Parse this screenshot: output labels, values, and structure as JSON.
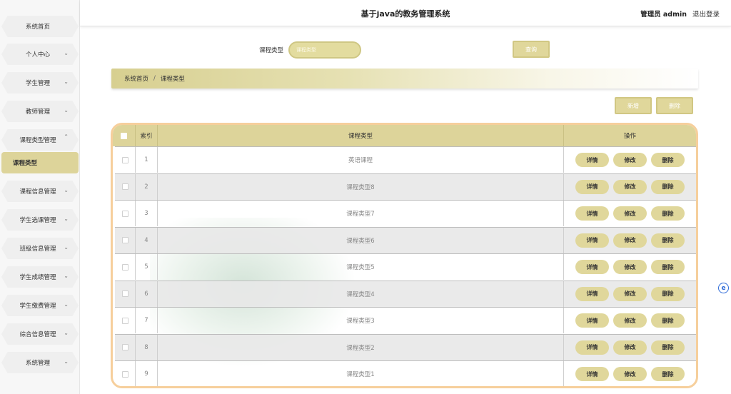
{
  "header": {
    "title": "基于java的教务管理系统",
    "user_label": "管理员 admin",
    "logout_label": "退出登录"
  },
  "sidebar": {
    "items": [
      {
        "label": "系统首页",
        "has_chevron": false
      },
      {
        "label": "个人中心",
        "has_chevron": true
      },
      {
        "label": "学生管理",
        "has_chevron": true
      },
      {
        "label": "教师管理",
        "has_chevron": true
      },
      {
        "label": "课程类型管理",
        "has_chevron": true,
        "expanded": true
      },
      {
        "label": "课程类型",
        "active": true
      },
      {
        "label": "课程信息管理",
        "has_chevron": true
      },
      {
        "label": "学生选课管理",
        "has_chevron": true
      },
      {
        "label": "班级信息管理",
        "has_chevron": true
      },
      {
        "label": "学生成绩管理",
        "has_chevron": true
      },
      {
        "label": "学生缴费管理",
        "has_chevron": true
      },
      {
        "label": "综合信息管理",
        "has_chevron": true
      },
      {
        "label": "系统管理",
        "has_chevron": true
      }
    ]
  },
  "search": {
    "label": "课程类型",
    "placeholder": "课程类型",
    "query_label": "查询"
  },
  "breadcrumb": {
    "home": "系统首页",
    "separator": "/",
    "current": "课程类型"
  },
  "actions": {
    "add_label": "新增",
    "delete_label": "删除"
  },
  "table": {
    "headers": {
      "index": "索引",
      "type": "课程类型",
      "ops": "操作"
    },
    "op_labels": {
      "detail": "详情",
      "edit": "修改",
      "delete": "删除"
    },
    "rows": [
      {
        "index": "1",
        "type": "英语课程"
      },
      {
        "index": "2",
        "type": "课程类型8"
      },
      {
        "index": "3",
        "type": "课程类型7"
      },
      {
        "index": "4",
        "type": "课程类型6"
      },
      {
        "index": "5",
        "type": "课程类型5"
      },
      {
        "index": "6",
        "type": "课程类型4"
      },
      {
        "index": "7",
        "type": "课程类型3"
      },
      {
        "index": "8",
        "type": "课程类型2"
      },
      {
        "index": "9",
        "type": "课程类型1"
      }
    ]
  },
  "colors": {
    "accent": "#ddd49a",
    "table_border": "#f6cf9c"
  }
}
